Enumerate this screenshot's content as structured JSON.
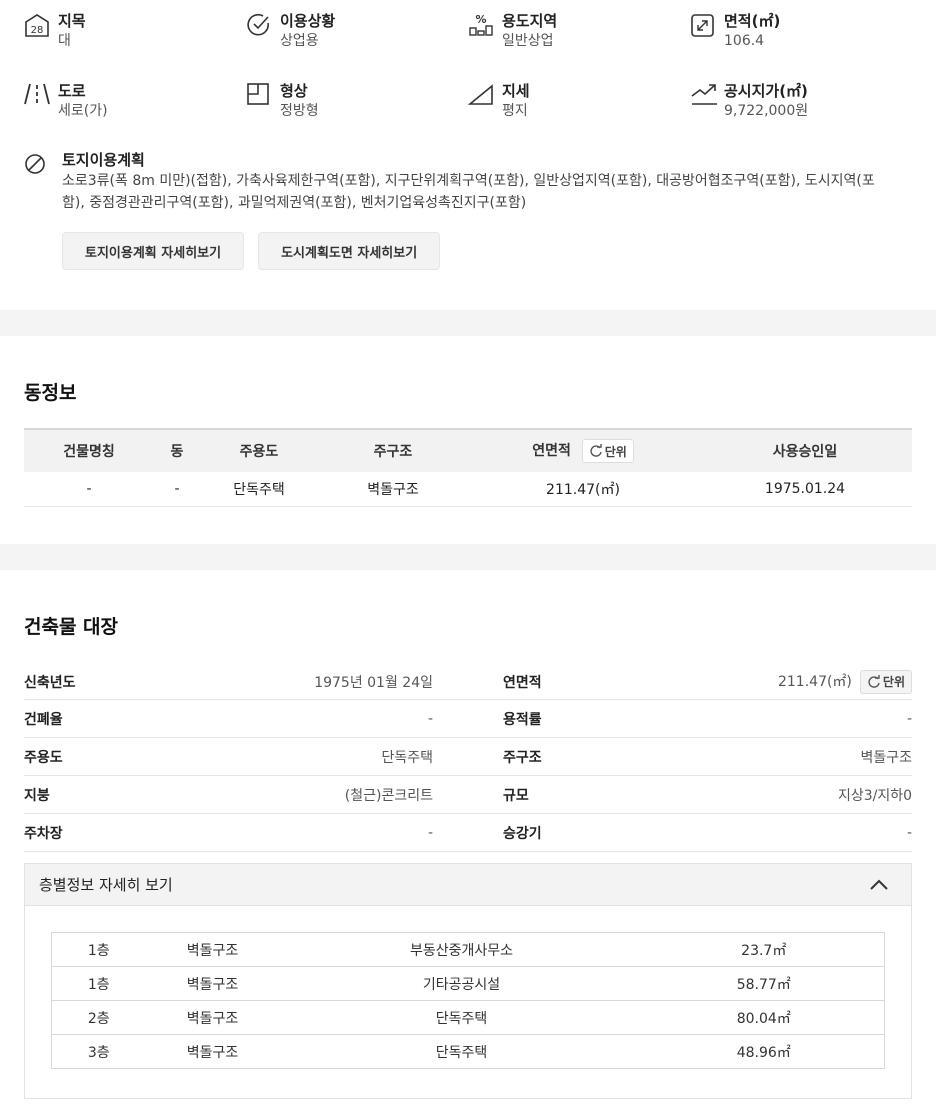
{
  "land": {
    "row1": [
      {
        "label": "지목",
        "value": "대",
        "icon": "land-category-icon"
      },
      {
        "label": "이용상황",
        "value": "상업용",
        "icon": "check-circle-icon"
      },
      {
        "label": "용도지역",
        "value": "일반상업",
        "icon": "percent-zone-icon"
      },
      {
        "label": "면적(㎡)",
        "value": "106.4",
        "icon": "expand-area-icon"
      }
    ],
    "row2": [
      {
        "label": "도로",
        "value": "세로(가)",
        "icon": "road-icon"
      },
      {
        "label": "형상",
        "value": "정방형",
        "icon": "shape-square-icon"
      },
      {
        "label": "지세",
        "value": "평지",
        "icon": "terrain-slope-icon"
      },
      {
        "label": "공시지가(㎡)",
        "value": "9,722,000원",
        "icon": "trend-up-icon"
      }
    ],
    "plan": {
      "label": "토지이용계획",
      "value": "소로3류(폭 8m 미만)(접함), 가축사육제한구역(포함), 지구단위계획구역(포함), 일반상업지역(포함), 대공방어협조구역(포함), 도시지역(포함), 중점경관관리구역(포함), 과밀억제권역(포함), 벤처기업육성촉진지구(포함)"
    },
    "buttons": {
      "plan_detail": "토지이용계획 자세히보기",
      "map_detail": "도시계획도면 자세히보기"
    }
  },
  "building": {
    "title": "동정보",
    "headers": [
      "건물명칭",
      "동",
      "주용도",
      "주구조",
      "연면적",
      "사용승인일"
    ],
    "unit_label": "단위",
    "row": [
      "-",
      "-",
      "단독주택",
      "벽돌구조",
      "211.47(㎡)",
      "1975.01.24"
    ]
  },
  "ledger": {
    "title": "건축물 대장",
    "unit_label": "단위",
    "rows": [
      {
        "lk": "신축년도",
        "lv": "1975년 01월 24일",
        "rk": "연면적",
        "rv": "211.47(㎡)"
      },
      {
        "lk": "건폐율",
        "lv": "-",
        "rk": "용적률",
        "rv": "-"
      },
      {
        "lk": "주용도",
        "lv": "단독주택",
        "rk": "주구조",
        "rv": "벽돌구조"
      },
      {
        "lk": "지붕",
        "lv": "(철근)콘크리트",
        "rk": "규모",
        "rv": "지상3/지하0"
      },
      {
        "lk": "주차장",
        "lv": "-",
        "rk": "승강기",
        "rv": "-"
      }
    ],
    "floor_title": "층별정보 자세히 보기",
    "floors": [
      [
        "1층",
        "벽돌구조",
        "부동산중개사무소",
        "23.7㎡"
      ],
      [
        "1층",
        "벽돌구조",
        "기타공공시설",
        "58.77㎡"
      ],
      [
        "2층",
        "벽돌구조",
        "단독주택",
        "80.04㎡"
      ],
      [
        "3층",
        "벽돌구조",
        "단독주택",
        "48.96㎡"
      ]
    ]
  }
}
